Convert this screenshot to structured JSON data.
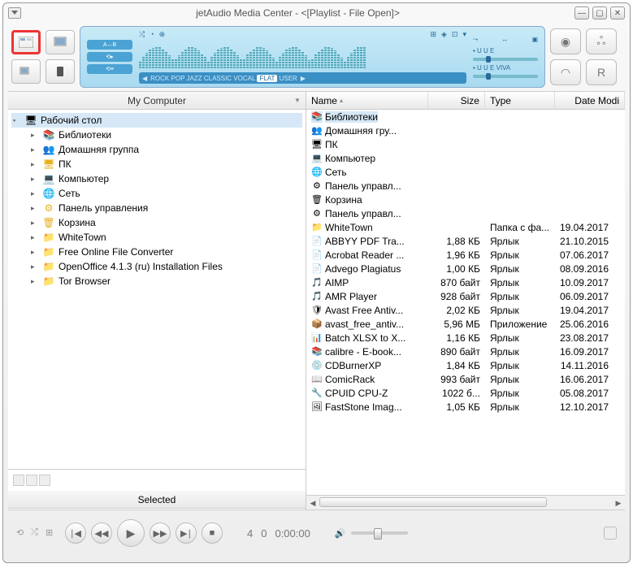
{
  "title": "jetAudio Media Center - <[Playlist - File Open]>",
  "presets": {
    "nav_l": "◀",
    "items": [
      "ROCK",
      "POP",
      "JAZZ",
      "CLASSIC",
      "VOCAL",
      "FLAT",
      "USER"
    ],
    "selected": "FLAT",
    "nav_r": "▶"
  },
  "disp_labels": {
    "bbe": "▪ U U E",
    "viva": "▪ U U E VIVA",
    "ab": "A↔B",
    "rpt": "⟲▸",
    "chip3": "⟲≡"
  },
  "left_header": "My Computer",
  "selected_header": "Selected",
  "tree": {
    "root": "Рабочий стол",
    "items": [
      {
        "icon": "📚",
        "label": "Библиотеки"
      },
      {
        "icon": "👥",
        "label": "Домашняя группа"
      },
      {
        "icon": "🖥",
        "label": "ПК"
      },
      {
        "icon": "💻",
        "label": "Компьютер"
      },
      {
        "icon": "🌐",
        "label": "Сеть"
      },
      {
        "icon": "⚙",
        "label": "Панель управления"
      },
      {
        "icon": "🗑",
        "label": "Корзина"
      },
      {
        "icon": "📁",
        "label": "WhiteTown"
      },
      {
        "icon": "📁",
        "label": "Free Online File Converter"
      },
      {
        "icon": "📁",
        "label": "OpenOffice 4.1.3 (ru) Installation Files"
      },
      {
        "icon": "📁",
        "label": "Tor Browser"
      }
    ]
  },
  "cols": {
    "name": "Name",
    "size": "Size",
    "type": "Type",
    "date": "Date Modi"
  },
  "files": [
    {
      "icon": "📚",
      "name": "Библиотеки",
      "size": "",
      "type": "",
      "date": "",
      "sel": true
    },
    {
      "icon": "👥",
      "name": "Домашняя гру...",
      "size": "",
      "type": "",
      "date": ""
    },
    {
      "icon": "🖥",
      "name": "ПК",
      "size": "",
      "type": "",
      "date": ""
    },
    {
      "icon": "💻",
      "name": "Компьютер",
      "size": "",
      "type": "",
      "date": ""
    },
    {
      "icon": "🌐",
      "name": "Сеть",
      "size": "",
      "type": "",
      "date": ""
    },
    {
      "icon": "⚙",
      "name": "Панель управл...",
      "size": "",
      "type": "",
      "date": ""
    },
    {
      "icon": "🗑",
      "name": "Корзина",
      "size": "",
      "type": "",
      "date": ""
    },
    {
      "icon": "⚙",
      "name": "Панель управл...",
      "size": "",
      "type": "",
      "date": ""
    },
    {
      "icon": "📁",
      "name": "WhiteTown",
      "size": "",
      "type": "Папка с фа...",
      "date": "19.04.2017"
    },
    {
      "icon": "📄",
      "name": "ABBYY PDF Tra...",
      "size": "1,88 КБ",
      "type": "Ярлык",
      "date": "21.10.2015"
    },
    {
      "icon": "📄",
      "name": "Acrobat Reader ...",
      "size": "1,96 КБ",
      "type": "Ярлык",
      "date": "07.06.2017"
    },
    {
      "icon": "📄",
      "name": "Advego Plagiatus",
      "size": "1,00 КБ",
      "type": "Ярлык",
      "date": "08.09.2016"
    },
    {
      "icon": "🎵",
      "name": "AIMP",
      "size": "870 байт",
      "type": "Ярлык",
      "date": "10.09.2017"
    },
    {
      "icon": "🎵",
      "name": "AMR Player",
      "size": "928 байт",
      "type": "Ярлык",
      "date": "06.09.2017"
    },
    {
      "icon": "🛡",
      "name": "Avast Free Antiv...",
      "size": "2,02 КБ",
      "type": "Ярлык",
      "date": "19.04.2017"
    },
    {
      "icon": "📦",
      "name": "avast_free_antiv...",
      "size": "5,96 МБ",
      "type": "Приложение",
      "date": "25.06.2016"
    },
    {
      "icon": "📊",
      "name": "Batch XLSX to X...",
      "size": "1,16 КБ",
      "type": "Ярлык",
      "date": "23.08.2017"
    },
    {
      "icon": "📚",
      "name": "calibre - E-book...",
      "size": "890 байт",
      "type": "Ярлык",
      "date": "16.09.2017"
    },
    {
      "icon": "💿",
      "name": "CDBurnerXP",
      "size": "1,84 КБ",
      "type": "Ярлык",
      "date": "14.11.2016"
    },
    {
      "icon": "📖",
      "name": "ComicRack",
      "size": "993 байт",
      "type": "Ярлык",
      "date": "16.06.2017"
    },
    {
      "icon": "🔧",
      "name": "CPUID CPU-Z",
      "size": "1022 б...",
      "type": "Ярлык",
      "date": "05.08.2017"
    },
    {
      "icon": "🖼",
      "name": "FastStone Imag...",
      "size": "1,05 КБ",
      "type": "Ярлык",
      "date": "12.10.2017"
    }
  ],
  "playbar": {
    "track": "4",
    "pos": "0",
    "time": "0:00:00"
  }
}
